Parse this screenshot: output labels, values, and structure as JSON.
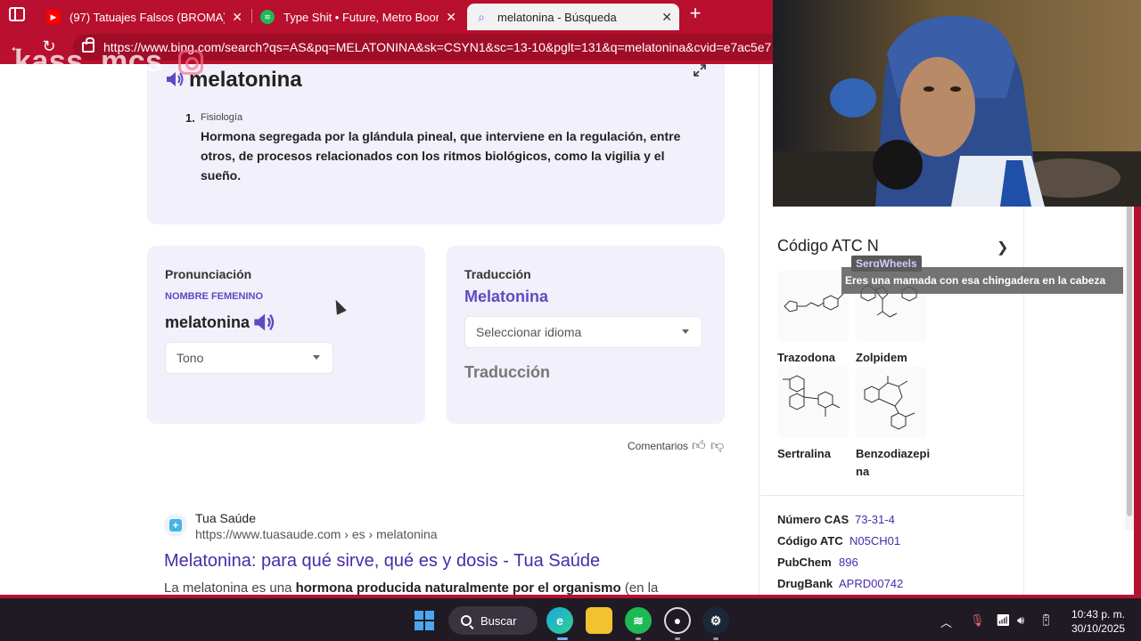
{
  "browser": {
    "tabs": [
      {
        "title": "(97) Tatuajes Falsos (BROMA) - Yo",
        "favicon": "youtube-icon",
        "color": "#ff0000"
      },
      {
        "title": "Type Shit • Future, Metro Boomin,",
        "favicon": "spotify-icon",
        "color": "#1db954"
      },
      {
        "title": "melatonina - Búsqueda",
        "favicon": "bing-search-icon",
        "color": "#7b6cf0"
      }
    ],
    "url": "https://www.bing.com/search?qs=AS&pq=MELATONINA&sk=CSYN1&sc=13-10&pglt=131&q=melatonina&cvid=e7ac5e7",
    "watermark": "kass_mcs"
  },
  "definition": {
    "word": "melatonina",
    "number": "1.",
    "category": "Fisiología",
    "text": "Hormona segregada por la glándula pineal, que interviene en la regulación, entre otros, de procesos relacionados con los ritmos biológicos, como la vigilia y el sueño."
  },
  "pronunciation": {
    "heading": "Pronunciación",
    "gender": "NOMBRE FEMENINO",
    "word": "melatonina",
    "tone_placeholder": "Tono"
  },
  "translation": {
    "heading": "Traducción",
    "word": "Melatonina",
    "language_placeholder": "Seleccionar idioma",
    "output": "Traducción"
  },
  "feedback": {
    "label": "Comentarios"
  },
  "result": {
    "site": "Tua Saúde",
    "url": "https://www.tuasaude.com › es › melatonina",
    "title": "Melatonina: para qué sirve, qué es y dosis - Tua Saúde",
    "snippet_pre": "La melatonina es una ",
    "snippet_bold": "hormona producida naturalmente por el organismo",
    "snippet_post": " (en la"
  },
  "side_panel": {
    "atc_title": "Código ATC N",
    "drugs": [
      {
        "name": "Trazodona"
      },
      {
        "name": "Zolpidem"
      },
      {
        "name": "Sertralina"
      },
      {
        "name": "Benzodiazepi\nna"
      }
    ],
    "properties": [
      {
        "key": "Número CAS",
        "value": "73-31-4"
      },
      {
        "key": "Código ATC",
        "value": "N05CH01"
      },
      {
        "key": "PubChem",
        "value": "896"
      },
      {
        "key": "DrugBank",
        "value": "APRD00742"
      }
    ]
  },
  "chat": {
    "username": "SergWheels",
    "message": "Eres una mamada con esa chingadera en la cabeza"
  },
  "taskbar": {
    "search_label": "Buscar",
    "time": "10:43 p. m.",
    "date": "30/10/2025"
  }
}
